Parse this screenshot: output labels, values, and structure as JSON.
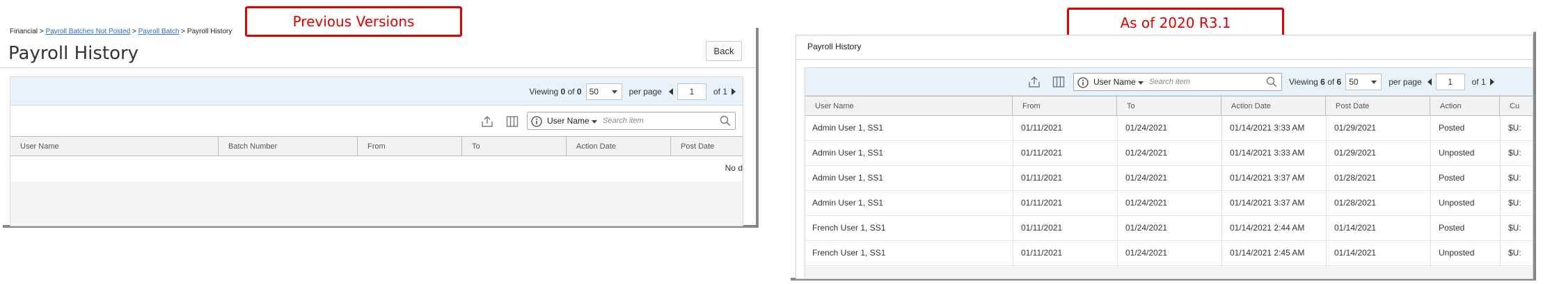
{
  "callouts": {
    "previous": "Previous Versions",
    "current": "As of 2020 R3.1"
  },
  "old": {
    "breadcrumb": {
      "root": "Financial",
      "sep": ">",
      "link1": "Payroll Batches Not Posted",
      "link2": "Payroll Batch",
      "current": "Payroll History"
    },
    "title": "Payroll History",
    "back_label": "Back",
    "pager": {
      "viewing": "Viewing",
      "count": "0",
      "of": "of",
      "total": "0",
      "per_page_value": "50",
      "per_page_label": "per page",
      "page": "1",
      "of_pages": "of 1"
    },
    "search": {
      "field": "User Name",
      "placeholder": "Search item"
    },
    "columns": [
      "User Name",
      "Batch Number",
      "From",
      "To",
      "Action Date",
      "Post Date"
    ],
    "empty_text": "No d"
  },
  "new": {
    "title": "Payroll History",
    "pager": {
      "viewing": "Viewing",
      "count": "6",
      "of": "of",
      "total": "6",
      "per_page_value": "50",
      "per_page_label": "per page",
      "page": "1",
      "of_pages": "of 1"
    },
    "search": {
      "field": "User Name",
      "placeholder": "Search item"
    },
    "columns": [
      "User Name",
      "From",
      "To",
      "Action Date",
      "Post Date",
      "Action",
      "Cu"
    ],
    "rows": [
      [
        "Admin User 1, SS1",
        "01/11/2021",
        "01/24/2021",
        "01/14/2021 3:33 AM",
        "01/29/2021",
        "Posted",
        "$U:"
      ],
      [
        "Admin User 1, SS1",
        "01/11/2021",
        "01/24/2021",
        "01/14/2021 3:33 AM",
        "01/29/2021",
        "Unposted",
        "$U:"
      ],
      [
        "Admin User 1, SS1",
        "01/11/2021",
        "01/24/2021",
        "01/14/2021 3:37 AM",
        "01/28/2021",
        "Posted",
        "$U:"
      ],
      [
        "Admin User 1, SS1",
        "01/11/2021",
        "01/24/2021",
        "01/14/2021 3:37 AM",
        "01/28/2021",
        "Unposted",
        "$U:"
      ],
      [
        "French User 1, SS1",
        "01/11/2021",
        "01/24/2021",
        "01/14/2021 2:44 AM",
        "01/14/2021",
        "Posted",
        "$U:"
      ],
      [
        "French User 1, SS1",
        "01/11/2021",
        "01/24/2021",
        "01/14/2021 2:45 AM",
        "01/14/2021",
        "Unposted",
        "$U:"
      ]
    ]
  },
  "colors": {
    "callout_red": "#e00000",
    "link_blue": "#2a6ebb",
    "pager_bg": "#eaf2f9",
    "frame_gray": "#888888"
  },
  "icons": [
    "export-icon",
    "columns-icon",
    "info-icon",
    "search-icon",
    "caret-down-icon",
    "prev-page-icon",
    "next-page-icon"
  ]
}
